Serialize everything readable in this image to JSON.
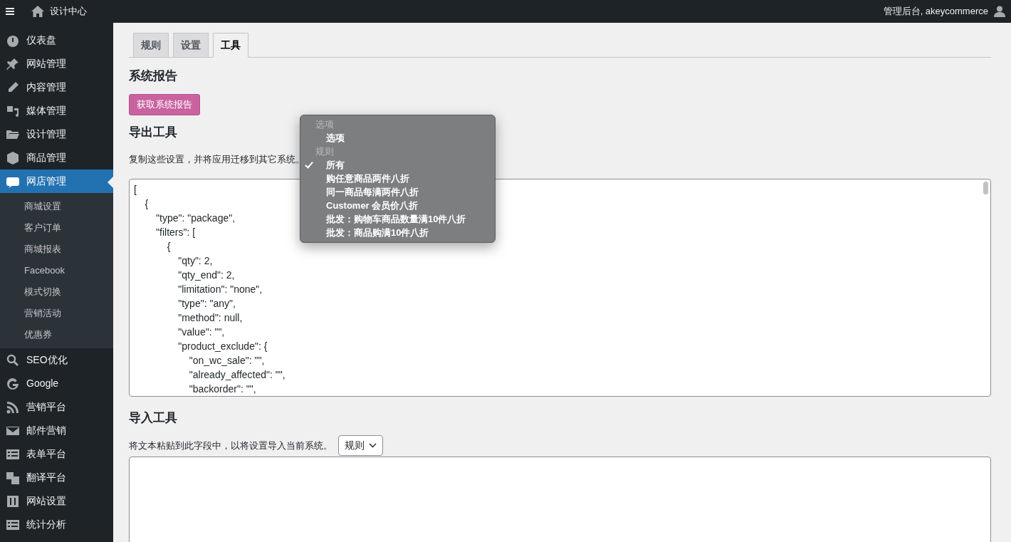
{
  "topbar": {
    "site_title": "设计中心",
    "account": "管理后台, akeycommerce"
  },
  "sidebar": {
    "items": [
      {
        "label": "仪表盘",
        "selected": false
      },
      {
        "label": "网站管理",
        "selected": false
      },
      {
        "label": "内容管理",
        "selected": false
      },
      {
        "label": "媒体管理",
        "selected": false
      },
      {
        "label": "设计管理",
        "selected": false
      },
      {
        "label": "商品管理",
        "selected": false
      },
      {
        "label": "网店管理",
        "selected": true,
        "children": [
          {
            "label": "商城设置"
          },
          {
            "label": "客户订单"
          },
          {
            "label": "商城报表"
          },
          {
            "label": "Facebook"
          },
          {
            "label": "模式切换"
          },
          {
            "label": "营销活动"
          },
          {
            "label": "优惠券"
          }
        ]
      },
      {
        "label": "SEO优化",
        "selected": false
      },
      {
        "label": "Google",
        "selected": false
      },
      {
        "label": "营销平台",
        "selected": false
      },
      {
        "label": "邮件营销",
        "selected": false
      },
      {
        "label": "表单平台",
        "selected": false
      },
      {
        "label": "翻译平台",
        "selected": false
      },
      {
        "label": "网站设置",
        "selected": false
      },
      {
        "label": "统计分析",
        "selected": false
      }
    ]
  },
  "tabs": [
    {
      "label": "规则",
      "selected": false
    },
    {
      "label": "设置",
      "selected": false
    },
    {
      "label": "工具",
      "selected": true
    }
  ],
  "system_report": {
    "heading": "系统报告",
    "button": "获取系统报告"
  },
  "export": {
    "heading": "导出工具",
    "description": "复制这些设置，并将应用迁移到其它系统。",
    "code_lines": [
      "[",
      "    {",
      "        \"type\": \"package\",",
      "        \"filters\": [",
      "            {",
      "                \"qty\": 2,",
      "                \"qty_end\": 2,",
      "                \"limitation\": \"none\",",
      "                \"type\": \"any\",",
      "                \"method\": null,",
      "                \"value\": \"\",",
      "                \"product_exclude\": {",
      "                    \"on_wc_sale\": \"\",",
      "                    \"already_affected\": \"\",",
      "                    \"backorder\": \"\","
    ]
  },
  "dropdown_menu": {
    "groups": [
      {
        "label": "选项",
        "options": [
          {
            "label": "选项",
            "selected": false
          }
        ]
      },
      {
        "label": "规则",
        "options": [
          {
            "label": "所有",
            "selected": true
          },
          {
            "label": "购任意商品两件八折",
            "selected": false
          },
          {
            "label": "同一商品每满两件八折",
            "selected": false
          },
          {
            "label": "Customer 会员价八折",
            "selected": false
          },
          {
            "label": "批发：购物车商品数量满10件八折",
            "selected": false
          },
          {
            "label": "批发：商品购满10件八折",
            "selected": false
          }
        ]
      }
    ]
  },
  "import": {
    "heading": "导入工具",
    "description": "将文本粘贴到此字段中，以将设置导入当前系统。",
    "select_value": "规则"
  }
}
